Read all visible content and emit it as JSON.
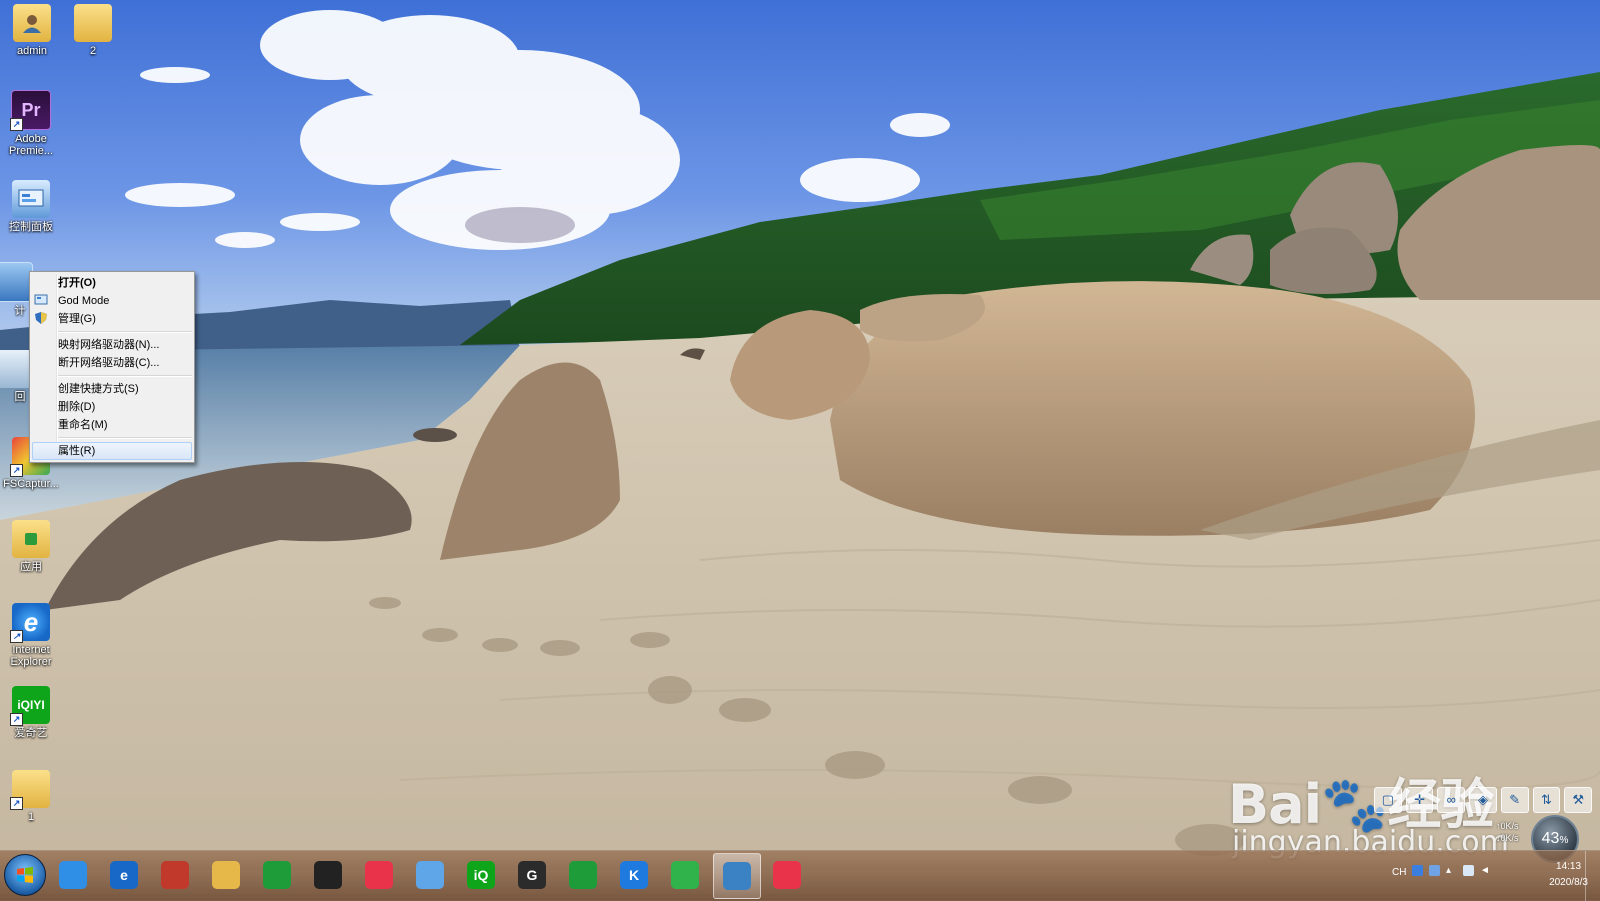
{
  "desktop": {
    "icons": [
      {
        "label": "admin",
        "icon": "user-folder-icon"
      },
      {
        "label": "2",
        "icon": "folder-icon"
      },
      {
        "label": "Adobe Premie...",
        "icon": "adobe-premiere-icon",
        "glyph": "Pr"
      },
      {
        "label": "控制面板",
        "icon": "control-panel-icon"
      },
      {
        "label": "计",
        "icon": "computer-icon"
      },
      {
        "label": "回",
        "icon": "recycle-bin-icon"
      },
      {
        "label": "FSCaptur...",
        "icon": "fscapture-icon"
      },
      {
        "label": "应用",
        "icon": "apps-folder-icon"
      },
      {
        "label": "Internet Explorer",
        "icon": "internet-explorer-icon",
        "glyph": "e"
      },
      {
        "label": "爱奇艺",
        "icon": "iqiyi-icon",
        "glyph": "iQIYI"
      },
      {
        "label": "1",
        "icon": "folder-icon"
      }
    ]
  },
  "context_menu": {
    "items": [
      {
        "label": "打开(O)",
        "bold": true
      },
      {
        "label": "God Mode",
        "icon": "god-mode-icon"
      },
      {
        "label": "管理(G)",
        "icon": "shield-icon"
      },
      {
        "separator": true
      },
      {
        "label": "映射网络驱动器(N)..."
      },
      {
        "label": "断开网络驱动器(C)..."
      },
      {
        "separator": true
      },
      {
        "label": "创建快捷方式(S)"
      },
      {
        "label": "删除(D)"
      },
      {
        "label": "重命名(M)"
      },
      {
        "separator": true
      },
      {
        "label": "属性(R)",
        "highlighted": true
      }
    ]
  },
  "taskbar": {
    "start_icon": "windows-start-icon",
    "apps": [
      {
        "icon": "browser-360-icon",
        "color": "#2f8fe6"
      },
      {
        "icon": "internet-explorer-icon",
        "color": "#1768c7",
        "glyph": "e"
      },
      {
        "icon": "game-icon",
        "color": "#c0392b"
      },
      {
        "icon": "file-explorer-icon",
        "color": "#e6b84a"
      },
      {
        "icon": "sheet-app-icon",
        "color": "#1e9c3a"
      },
      {
        "icon": "qq-icon",
        "color": "#222222"
      },
      {
        "icon": "youku-icon",
        "color": "#e8334a"
      },
      {
        "icon": "paper-plane-icon",
        "color": "#5ea6e8"
      },
      {
        "icon": "iqiyi-icon",
        "color": "#0fa51a",
        "glyph": "iQ"
      },
      {
        "icon": "g-app-icon",
        "color": "#2b2b2b",
        "glyph": "G"
      },
      {
        "icon": "sheet-app-icon",
        "color": "#1e9c3a"
      },
      {
        "icon": "kugou-icon",
        "color": "#1f7ae0",
        "glyph": "K"
      },
      {
        "icon": "media-player-icon",
        "color": "#2fb34a"
      },
      {
        "icon": "fscapture-taskbar-icon",
        "color": "#3b82c4"
      },
      {
        "icon": "youku-icon",
        "color": "#e8334a"
      }
    ],
    "active_index": 13,
    "tray": {
      "lang": "CH",
      "time": "14:13",
      "date": "2020/8/3"
    }
  },
  "overlay": {
    "perf_percent": "43",
    "perf_unit": "%",
    "net_up": "0",
    "net_unit": "K/s",
    "net_down": "0",
    "watermark_brand": "Bai",
    "watermark_text": "经验",
    "watermark_url": "jingyan.baidu.com"
  },
  "colors": {
    "menu_bg": "#f0f0f0",
    "menu_highlight": "#d9e6f7",
    "taskbar": "#8a6446"
  }
}
